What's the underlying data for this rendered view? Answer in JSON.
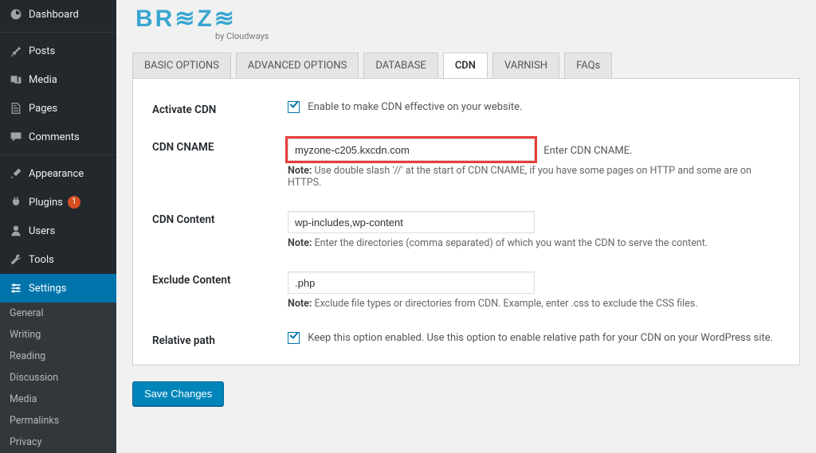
{
  "sidebar": {
    "items": [
      {
        "icon": "dashboard-icon",
        "label": "Dashboard"
      },
      {
        "icon": "pin-icon",
        "label": "Posts"
      },
      {
        "icon": "media-icon",
        "label": "Media"
      },
      {
        "icon": "page-icon",
        "label": "Pages"
      },
      {
        "icon": "comment-icon",
        "label": "Comments"
      },
      {
        "icon": "brush-icon",
        "label": "Appearance"
      },
      {
        "icon": "plug-icon",
        "label": "Plugins",
        "badge": "1"
      },
      {
        "icon": "user-icon",
        "label": "Users"
      },
      {
        "icon": "wrench-icon",
        "label": "Tools"
      },
      {
        "icon": "sliders-icon",
        "label": "Settings",
        "active": true
      }
    ],
    "sub": [
      "General",
      "Writing",
      "Reading",
      "Discussion",
      "Media",
      "Permalinks",
      "Privacy"
    ]
  },
  "logo": {
    "brand": "BR≋Z≋",
    "tagline": "by Cloudways"
  },
  "tabs": [
    {
      "label": "BASIC OPTIONS"
    },
    {
      "label": "ADVANCED OPTIONS"
    },
    {
      "label": "DATABASE"
    },
    {
      "label": "CDN",
      "active": true
    },
    {
      "label": "VARNISH"
    },
    {
      "label": "FAQs"
    }
  ],
  "form": {
    "activate": {
      "label": "Activate CDN",
      "checked": true,
      "text": "Enable to make CDN effective on your website."
    },
    "cname": {
      "label": "CDN CNAME",
      "value": "myzone-c205.kxcdn.com",
      "hint": "Enter CDN CNAME.",
      "note_prefix": "Note:",
      "note": " Use double slash '//' at the start of CDN CNAME, if you have some pages on HTTP and some are on HTTPS."
    },
    "content": {
      "label": "CDN Content",
      "value": "wp-includes,wp-content",
      "note_prefix": "Note:",
      "note": " Enter the directories (comma separated) of which you want the CDN to serve the content."
    },
    "exclude": {
      "label": "Exclude Content",
      "value": ".php",
      "note_prefix": "Note:",
      "note": " Exclude file types or directories from CDN. Example, enter .css to exclude the CSS files."
    },
    "relative": {
      "label": "Relative path",
      "checked": true,
      "text": "Keep this option enabled. Use this option to enable relative path for your CDN on your WordPress site."
    }
  },
  "save_button": "Save Changes"
}
